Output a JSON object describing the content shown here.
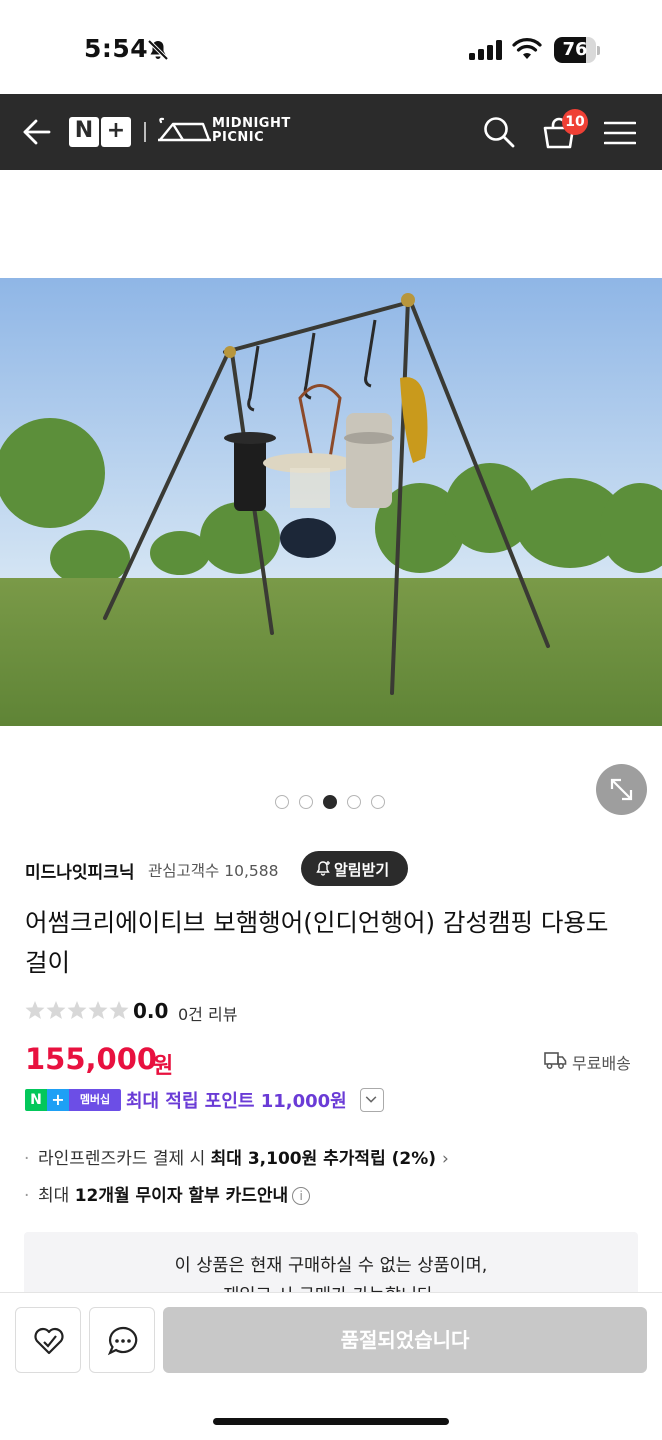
{
  "status_bar": {
    "time": "5:54",
    "battery_level": 76,
    "battery_text": "76"
  },
  "header": {
    "logo_n": "N",
    "logo_plus": "+",
    "brand_line1": "MIDNIGHT",
    "brand_line2": "PICNIC",
    "cart_count": "10"
  },
  "gallery": {
    "image_count": 5,
    "active_index": 2
  },
  "store": {
    "name": "미드나잇피크닉",
    "followers": "관심고객수 10,588",
    "alarm_label": "알림받기"
  },
  "product": {
    "title": "어썸크리에이티브 보햄행어(인디언행어) 감성캠핑 다용도 걸이",
    "rating": "0.0",
    "review_count": "0건 리뷰",
    "price": "155,000",
    "price_unit": "원",
    "shipping": "무료배송"
  },
  "membership": {
    "badge_n": "N",
    "badge_plus": "+",
    "badge_label": "멤버십",
    "points_text": "최대 적립 포인트 11,000원"
  },
  "benefits": {
    "line1_prefix": "라인프렌즈카드 결제 시 ",
    "line1_bold": "최대 3,100원 추가적립 (2%)",
    "line1_chevron": "›",
    "line2_prefix": "최대 ",
    "line2_bold": "12개월 무이자 할부 카드안내",
    "line2_info": "i"
  },
  "notice": {
    "line1": "이 상품은 현재 구매하실 수 없는 상품이며,",
    "line2": "재입고 시 구매가 가능합니다."
  },
  "bottom_bar": {
    "soldout_label": "품절되었습니다"
  },
  "colors": {
    "header_bg": "#2b2b2b",
    "price": "#e8113f",
    "points": "#6a3bd6",
    "badge": "#ef4035"
  }
}
